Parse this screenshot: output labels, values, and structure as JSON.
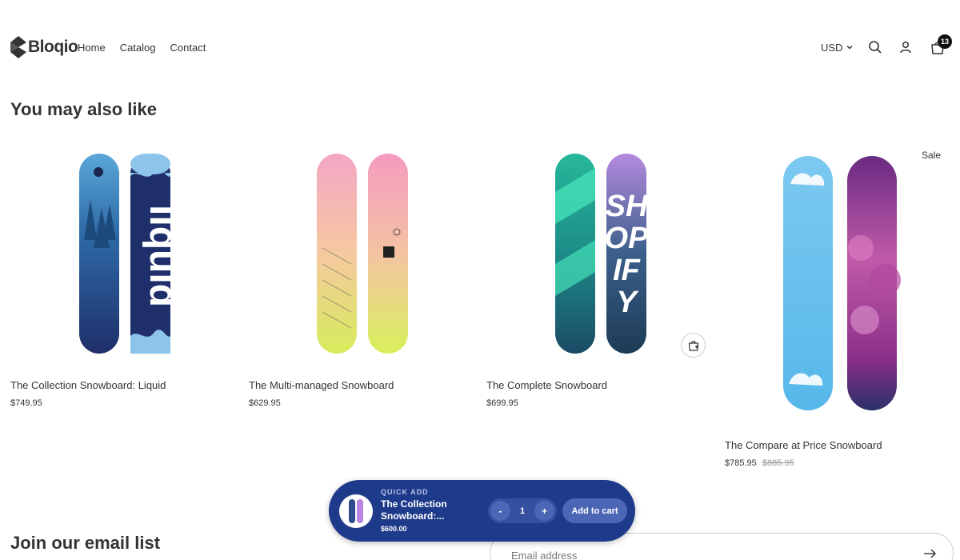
{
  "header": {
    "logo_text": "Bloqio",
    "nav": [
      "Home",
      "Catalog",
      "Contact"
    ],
    "currency": "USD",
    "cart_count": "13"
  },
  "related": {
    "title": "You may also like",
    "sale_label": "Sale",
    "products": [
      {
        "name": "The Collection Snowboard: Liquid",
        "price": "$749.95"
      },
      {
        "name": "The Multi-managed Snowboard",
        "price": "$629.95"
      },
      {
        "name": "The Complete Snowboard",
        "price": "$699.95"
      },
      {
        "name": "The Compare at Price Snowboard",
        "price": "$785.95",
        "compare_price": "$885.95"
      }
    ]
  },
  "newsletter": {
    "title": "Join our email list",
    "placeholder": "Email address"
  },
  "quick_add": {
    "label": "QUICK ADD",
    "product_name": "The Collection Snowboard:...",
    "price": "$600.00",
    "minus": "-",
    "quantity": "1",
    "plus": "+",
    "add_label": "Add to cart"
  },
  "colors": {
    "quick_add_bg": "#1e3a8a",
    "accent": "#4a66b4"
  }
}
